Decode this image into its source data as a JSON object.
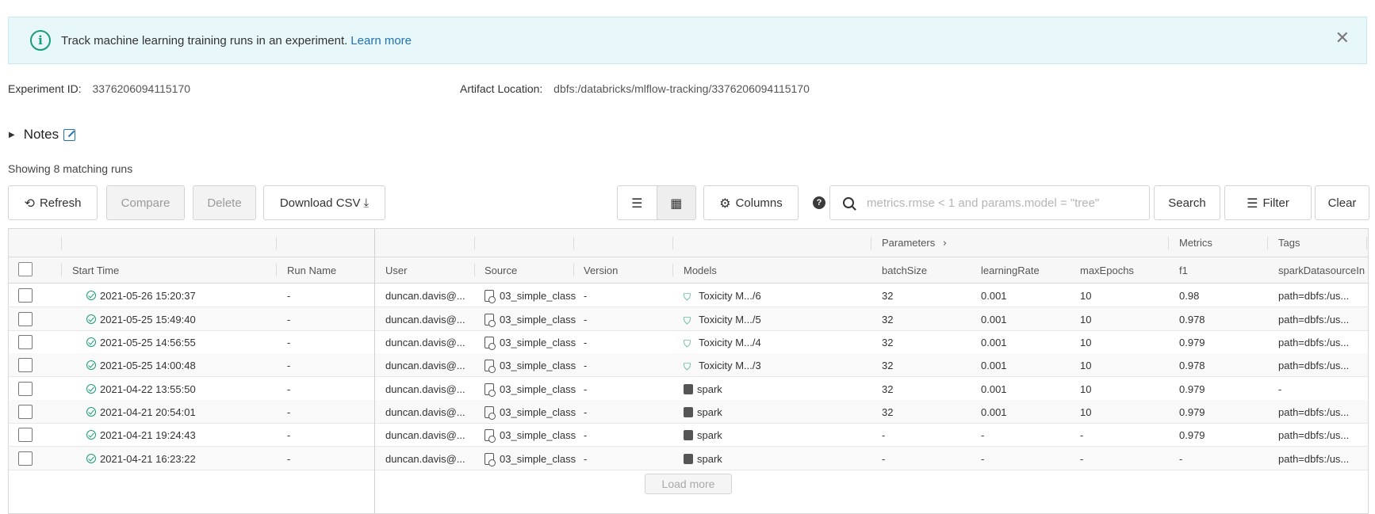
{
  "banner": {
    "text": "Track machine learning training runs in an experiment.",
    "link": "Learn more"
  },
  "meta": {
    "experiment_id_label": "Experiment ID:",
    "experiment_id": "3376206094115170",
    "artifact_label": "Artifact Location:",
    "artifact_location": "dbfs:/databricks/mlflow-tracking/3376206094115170"
  },
  "notes_label": "Notes",
  "showing": "Showing 8 matching runs",
  "toolbar": {
    "refresh": "Refresh",
    "compare": "Compare",
    "delete": "Delete",
    "download_csv": "Download CSV",
    "columns": "Columns",
    "search_placeholder": "metrics.rmse < 1 and params.model = \"tree\"",
    "search": "Search",
    "filter": "Filter",
    "clear": "Clear"
  },
  "table": {
    "groups": {
      "parameters": "Parameters",
      "metrics": "Metrics",
      "tags": "Tags"
    },
    "headers": {
      "start_time": "Start Time",
      "run_name": "Run Name",
      "user": "User",
      "source": "Source",
      "version": "Version",
      "models": "Models",
      "batch_size": "batchSize",
      "learning_rate": "learningRate",
      "max_epochs": "maxEpochs",
      "f1": "f1",
      "tag": "sparkDatasourceIn"
    },
    "rows": [
      {
        "start": "2021-05-26 15:20:37",
        "run_name": "-",
        "user": "duncan.davis@...",
        "source": "03_simple_class",
        "version": "-",
        "model": "Toxicity M.../6",
        "model_kind": "registered",
        "batch": "32",
        "lr": "0.001",
        "epochs": "10",
        "f1": "0.98",
        "tag": "path=dbfs:/us..."
      },
      {
        "start": "2021-05-25 15:49:40",
        "run_name": "-",
        "user": "duncan.davis@...",
        "source": "03_simple_class",
        "version": "-",
        "model": "Toxicity M.../5",
        "model_kind": "registered",
        "batch": "32",
        "lr": "0.001",
        "epochs": "10",
        "f1": "0.978",
        "tag": "path=dbfs:/us..."
      },
      {
        "start": "2021-05-25 14:56:55",
        "run_name": "-",
        "user": "duncan.davis@...",
        "source": "03_simple_class",
        "version": "-",
        "model": "Toxicity M.../4",
        "model_kind": "registered",
        "batch": "32",
        "lr": "0.001",
        "epochs": "10",
        "f1": "0.979",
        "tag": "path=dbfs:/us..."
      },
      {
        "start": "2021-05-25 14:00:48",
        "run_name": "-",
        "user": "duncan.davis@...",
        "source": "03_simple_class",
        "version": "-",
        "model": "Toxicity M.../3",
        "model_kind": "registered",
        "batch": "32",
        "lr": "0.001",
        "epochs": "10",
        "f1": "0.978",
        "tag": "path=dbfs:/us..."
      },
      {
        "start": "2021-04-22 13:55:50",
        "run_name": "-",
        "user": "duncan.davis@...",
        "source": "03_simple_class",
        "version": "-",
        "model": "spark",
        "model_kind": "logged",
        "batch": "32",
        "lr": "0.001",
        "epochs": "10",
        "f1": "0.979",
        "tag": "-"
      },
      {
        "start": "2021-04-21 20:54:01",
        "run_name": "-",
        "user": "duncan.davis@...",
        "source": "03_simple_class",
        "version": "-",
        "model": "spark",
        "model_kind": "logged",
        "batch": "32",
        "lr": "0.001",
        "epochs": "10",
        "f1": "0.979",
        "tag": "path=dbfs:/us..."
      },
      {
        "start": "2021-04-21 19:24:43",
        "run_name": "-",
        "user": "duncan.davis@...",
        "source": "03_simple_class",
        "version": "-",
        "model": "spark",
        "model_kind": "logged",
        "batch": "-",
        "lr": "-",
        "epochs": "-",
        "f1": "0.979",
        "tag": "path=dbfs:/us..."
      },
      {
        "start": "2021-04-21 16:23:22",
        "run_name": "-",
        "user": "duncan.davis@...",
        "source": "03_simple_class",
        "version": "-",
        "model": "spark",
        "model_kind": "logged",
        "batch": "-",
        "lr": "-",
        "epochs": "-",
        "f1": "-",
        "tag": "path=dbfs:/us..."
      }
    ],
    "load_more": "Load more"
  }
}
